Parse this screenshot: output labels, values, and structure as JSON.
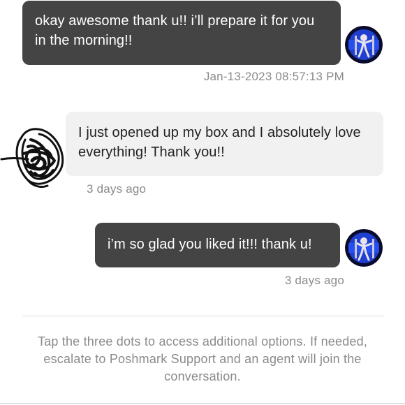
{
  "conversation": {
    "messages": [
      {
        "sender": "me",
        "text": "okay awesome thank u!! i’ll prepare it for you in the morning!!",
        "timestamp": "Jan-13-2023 08:57:13 PM"
      },
      {
        "sender": "buyer",
        "text": "I just opened up my box and I absolutely love everything! Thank you!!",
        "timestamp": "3 days ago"
      },
      {
        "sender": "me",
        "text": "i’m so glad you liked it!!! thank u!",
        "timestamp": "3 days ago"
      }
    ],
    "info_text": "Tap the three dots to access additional options. If needed, escalate to Poshmark Support and an agent will join the conversation."
  },
  "colors": {
    "my_bubble": "#444444",
    "their_bubble": "#f1f1f1",
    "muted_text": "#8a8a8a"
  },
  "icons": {
    "my_avatar": "user-avatar-icon",
    "buyer_avatar": "scribbled-avatar-icon"
  }
}
